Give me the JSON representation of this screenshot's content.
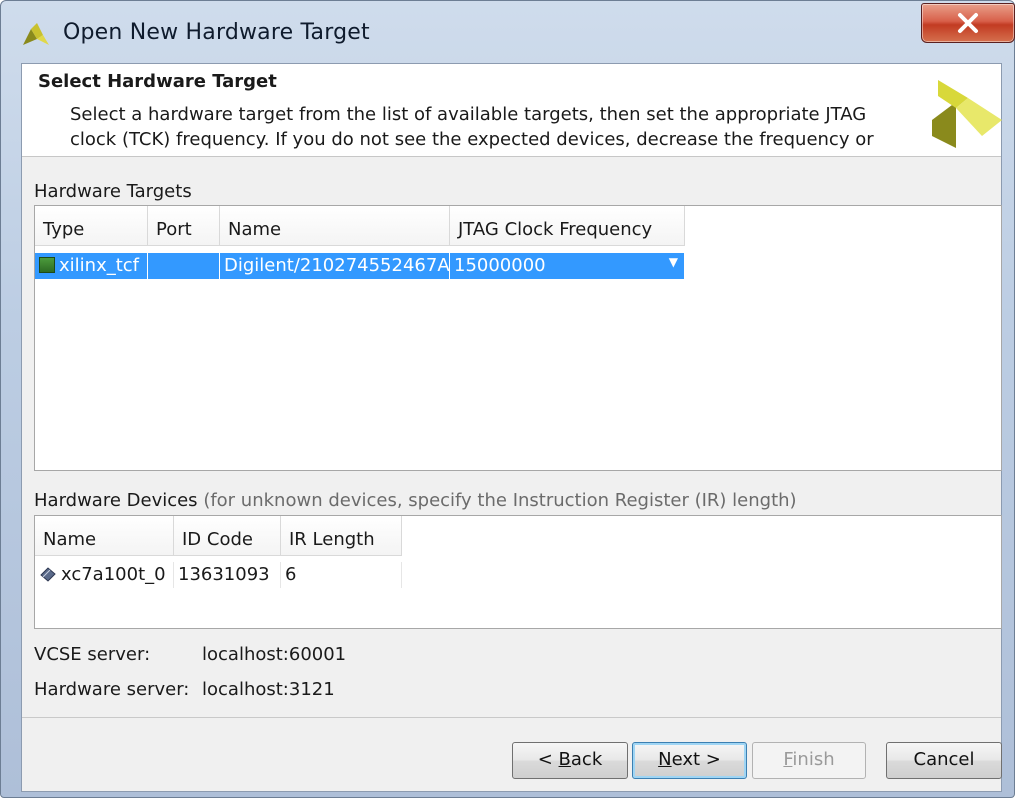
{
  "window": {
    "title": "Open New Hardware Target",
    "close_symbol": "X"
  },
  "header": {
    "title": "Select Hardware Target",
    "description": "Select a hardware target from the list of available targets, then set the appropriate JTAG clock (TCK) frequency. If you do not see the expected devices, decrease the frequency or"
  },
  "hardware_targets": {
    "label": "Hardware Targets",
    "columns": [
      "Type",
      "Port",
      "Name",
      "JTAG Clock Frequency"
    ],
    "rows": [
      {
        "type": "xilinx_tcf",
        "port": "",
        "name": "Digilent/210274552467A",
        "frequency": "15000000"
      }
    ]
  },
  "hardware_devices": {
    "label": "Hardware Devices",
    "hint": "(for unknown devices, specify the Instruction Register (IR) length)",
    "columns": [
      "Name",
      "ID Code",
      "IR Length"
    ],
    "rows": [
      {
        "name": "xc7a100t_0",
        "id_code": "13631093",
        "ir_length": "6"
      }
    ]
  },
  "servers": {
    "vcse_label": "VCSE server:",
    "vcse_value": "localhost:60001",
    "hw_label": "Hardware server:",
    "hw_value": "localhost:3121"
  },
  "buttons": {
    "back_prefix": "< ",
    "back_mnemonic": "B",
    "back_rest": "ack",
    "next_mnemonic": "N",
    "next_rest": "ext >",
    "finish_mnemonic": "F",
    "finish_rest": "inish",
    "cancel": "Cancel"
  },
  "colors": {
    "selection": "#3399ff",
    "close_button": "#c23b22",
    "logo_dark": "#8a8a1c",
    "logo_light": "#d8d83a"
  }
}
